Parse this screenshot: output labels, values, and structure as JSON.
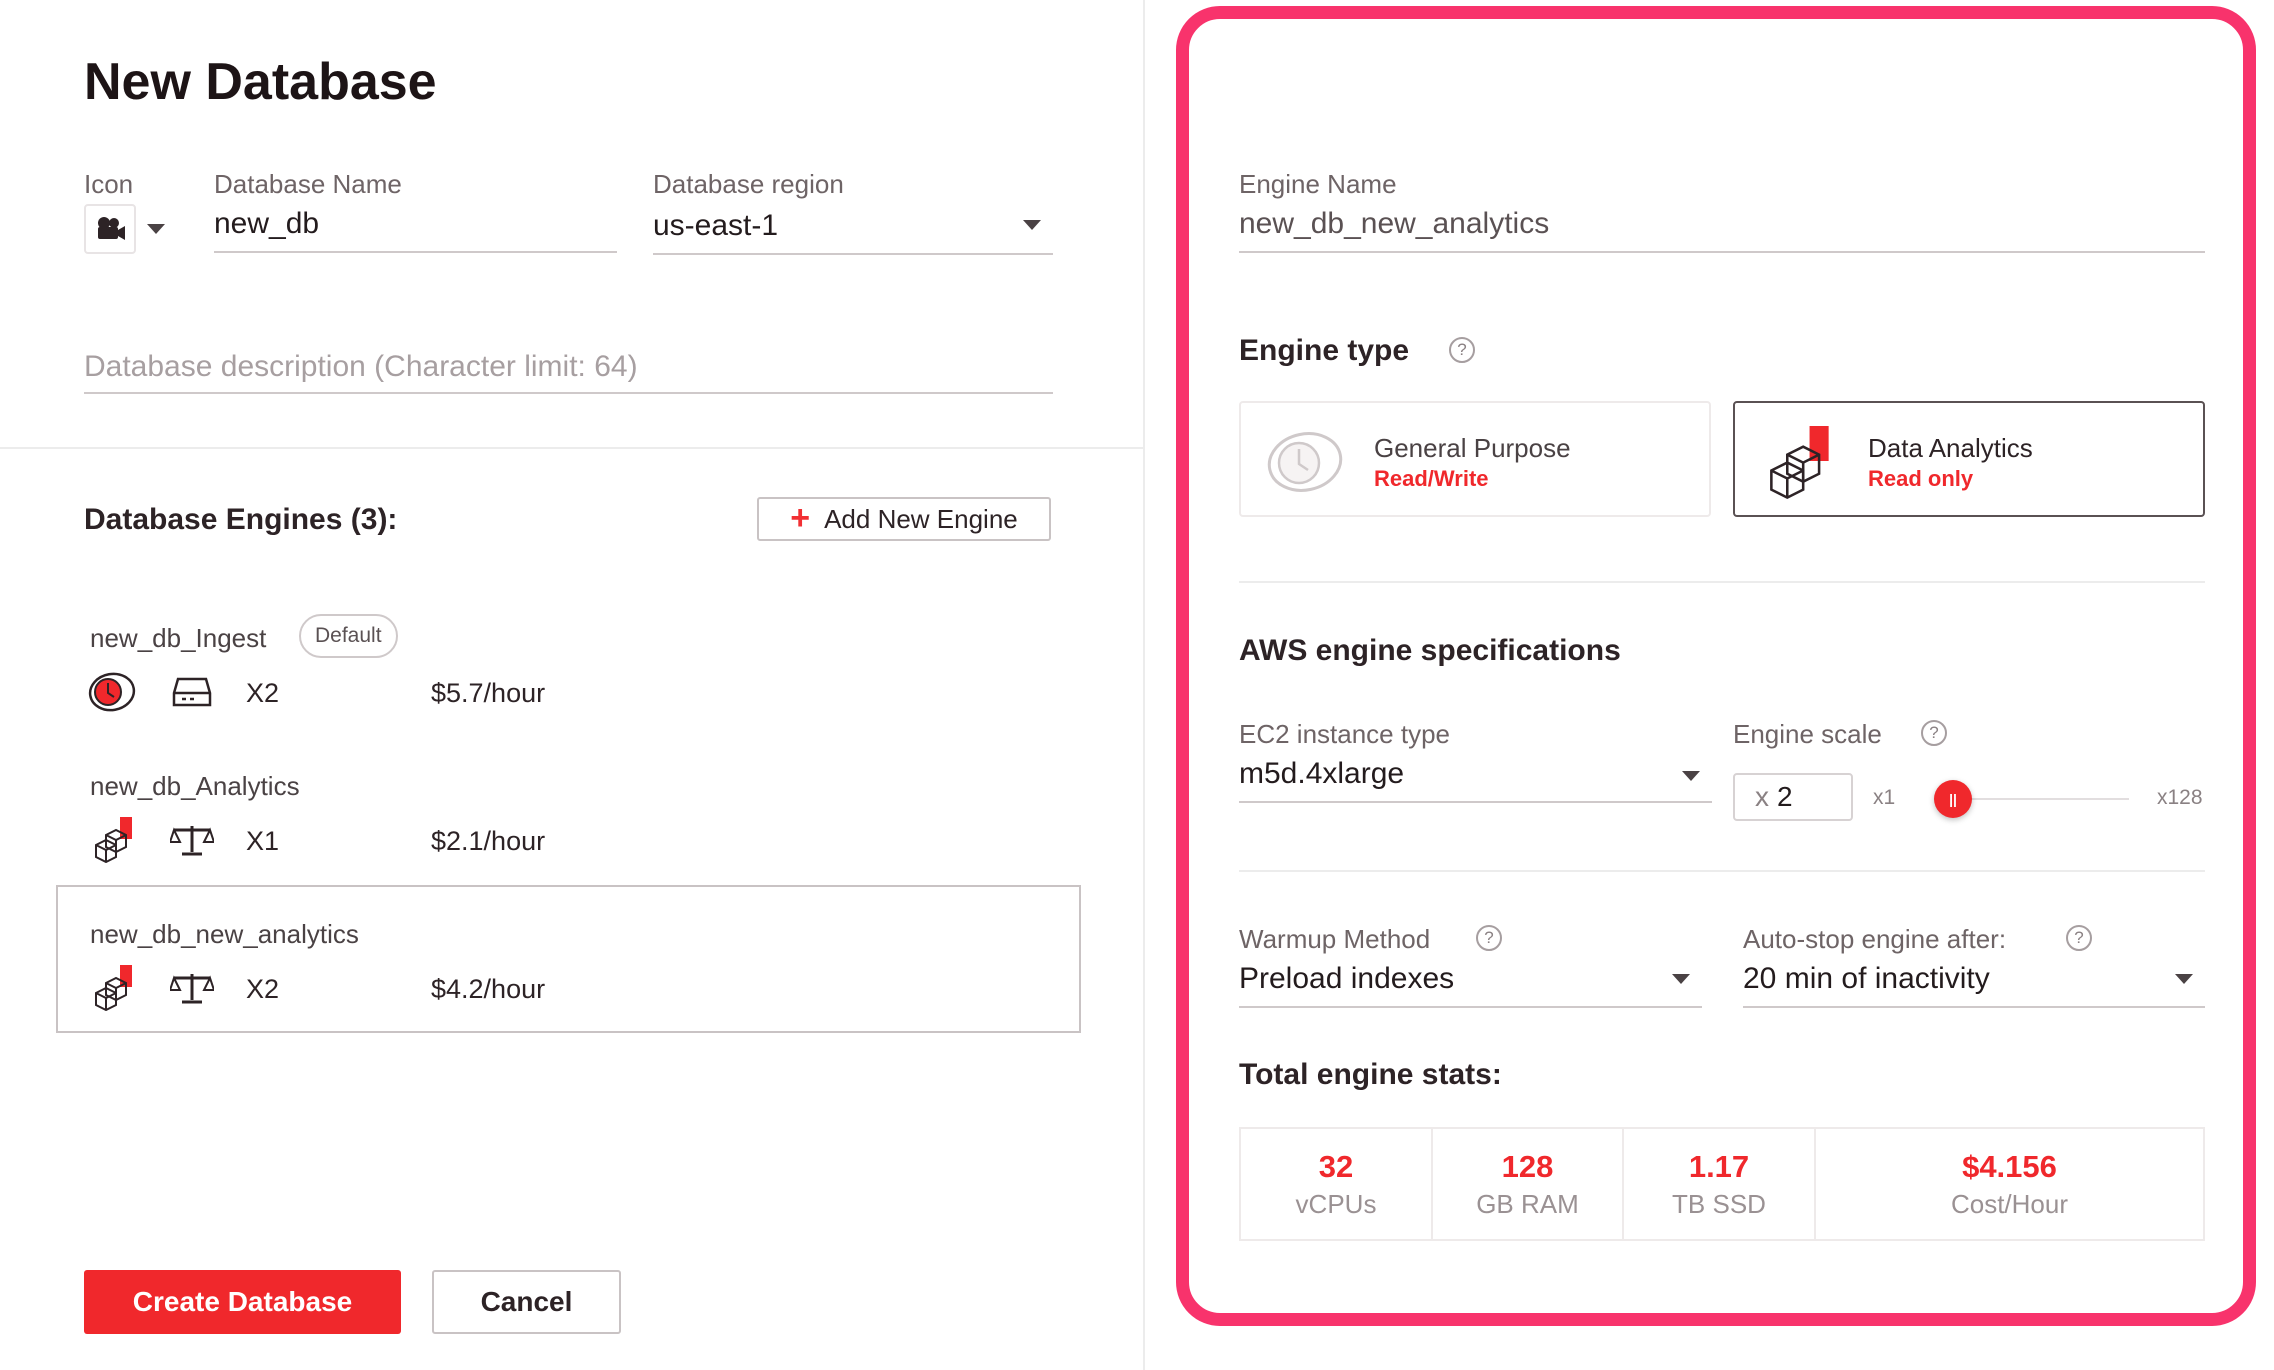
{
  "left": {
    "title": "New Database",
    "icon_label": "Icon",
    "name_label": "Database Name",
    "name_value": "new_db",
    "region_label": "Database region",
    "region_value": "us-east-1",
    "description_placeholder": "Database description (Character limit: 64)",
    "engines_title": "Database Engines (3):",
    "add_engine_label": "Add New Engine",
    "engines": [
      {
        "name": "new_db_Ingest",
        "badge": "Default",
        "type_icon": "general-purpose-icon",
        "size_icon": "storage-icon",
        "scale": "X2",
        "cost": "$5.7/hour"
      },
      {
        "name": "new_db_Analytics",
        "type_icon": "data-analytics-icon",
        "size_icon": "balance-icon",
        "scale": "X1",
        "cost": "$2.1/hour"
      },
      {
        "name": "new_db_new_analytics",
        "type_icon": "data-analytics-icon",
        "size_icon": "balance-icon",
        "scale": "X2",
        "cost": "$4.2/hour"
      }
    ],
    "create_label": "Create Database",
    "cancel_label": "Cancel"
  },
  "right": {
    "engine_name_label": "Engine Name",
    "engine_name_value": "new_db_new_analytics",
    "engine_type_title": "Engine type",
    "types": [
      {
        "title": "General Purpose",
        "sub": "Read/Write"
      },
      {
        "title": "Data Analytics",
        "sub": "Read only"
      }
    ],
    "aws_title": "AWS engine specifications",
    "ec2_label": "EC2 instance type",
    "ec2_value": "m5d.4xlarge",
    "scale_label": "Engine scale",
    "scale_prefix": "x",
    "scale_value": "2",
    "slider_min": "x1",
    "slider_max": "x128",
    "warmup_label": "Warmup Method",
    "warmup_value": "Preload indexes",
    "autostop_label": "Auto-stop engine after:",
    "autostop_value": "20 min of inactivity",
    "stats_title": "Total engine stats:",
    "stats": [
      {
        "num": "32",
        "unit": "vCPUs"
      },
      {
        "num": "128",
        "unit": "GB RAM"
      },
      {
        "num": "1.17",
        "unit": "TB SSD"
      },
      {
        "num": "$4.156",
        "unit": "Cost/Hour"
      }
    ]
  },
  "colors": {
    "accent": "#f0282c",
    "highlight_border": "#f8336c"
  }
}
